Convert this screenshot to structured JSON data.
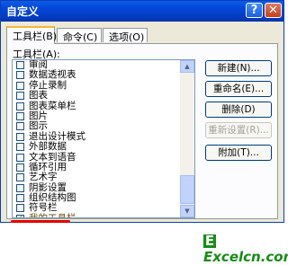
{
  "window": {
    "title": "自定义"
  },
  "titlebar_buttons": {
    "help": "?",
    "close": "✕"
  },
  "tabs": [
    {
      "label": "工具栏(B)",
      "active": true
    },
    {
      "label": "命令(C)",
      "active": false
    },
    {
      "label": "选项(O)",
      "active": false
    }
  ],
  "toolbar_list": {
    "label": "工具栏(A):",
    "items": [
      {
        "label": "审阅",
        "checked": false
      },
      {
        "label": "数据透视表",
        "checked": false
      },
      {
        "label": "停止录制",
        "checked": false
      },
      {
        "label": "图表",
        "checked": false
      },
      {
        "label": "图表菜单栏",
        "checked": false
      },
      {
        "label": "图片",
        "checked": false
      },
      {
        "label": "图示",
        "checked": false
      },
      {
        "label": "退出设计模式",
        "checked": false
      },
      {
        "label": "外部数据",
        "checked": false
      },
      {
        "label": "文本到语音",
        "checked": false
      },
      {
        "label": "循环引用",
        "checked": false
      },
      {
        "label": "艺术字",
        "checked": false
      },
      {
        "label": "阴影设置",
        "checked": false
      },
      {
        "label": "组织结构图",
        "checked": false
      },
      {
        "label": "符号栏",
        "checked": false
      },
      {
        "label": "我的工具栏",
        "checked": true
      }
    ]
  },
  "buttons": {
    "new": "新建(N)...",
    "rename": "重命名(E)...",
    "delete": "删除(D)",
    "reset": "重新设置(R)...",
    "attach": "附加(T)..."
  },
  "colors": {
    "title_bar": "#0446d6",
    "dialog_bg": "#ece9d8",
    "red_mark": "#e00000",
    "watermark": "#1a8a1a"
  },
  "watermark": {
    "text": "Excelcn.com"
  }
}
